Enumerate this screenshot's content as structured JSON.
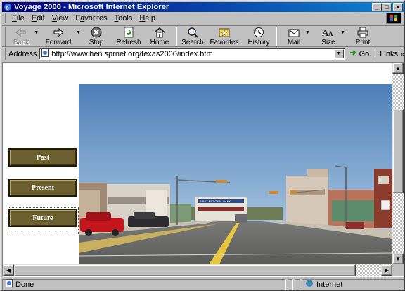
{
  "window": {
    "title": "Voyage 2000 - Microsoft Internet Explorer",
    "controls": {
      "minimize": "_",
      "maximize": "□",
      "close": "×"
    }
  },
  "menu": [
    {
      "label": "File",
      "key": "F",
      "rest": "ile"
    },
    {
      "label": "Edit",
      "key": "E",
      "rest": "dit"
    },
    {
      "label": "View",
      "key": "V",
      "rest": "iew"
    },
    {
      "label": "Favorites",
      "key": "a",
      "pre": "F",
      "rest": "vorites"
    },
    {
      "label": "Tools",
      "key": "T",
      "rest": "ools"
    },
    {
      "label": "Help",
      "key": "H",
      "rest": "elp"
    }
  ],
  "toolbar": {
    "back": "Back",
    "forward": "Forward",
    "stop": "Stop",
    "refresh": "Refresh",
    "home": "Home",
    "search": "Search",
    "favorites": "Favorites",
    "history": "History",
    "mail": "Mail",
    "size": "Size",
    "print": "Print"
  },
  "address": {
    "label": "Address",
    "url": "http://www.hen.sprnet.org/texas2000/index.htm",
    "go": "Go",
    "links": "Links"
  },
  "page": {
    "nav": {
      "past": "Past",
      "present": "Present",
      "future": "Future"
    },
    "photo": {
      "sign": "FIRST NATIONAL BANK"
    }
  },
  "status": {
    "text": "Done",
    "zone": "Internet"
  },
  "colors": {
    "titlebar_start": "#000080",
    "titlebar_end": "#1084d0",
    "nav_button": "#6b5f30",
    "chrome": "#c0c0c0"
  }
}
